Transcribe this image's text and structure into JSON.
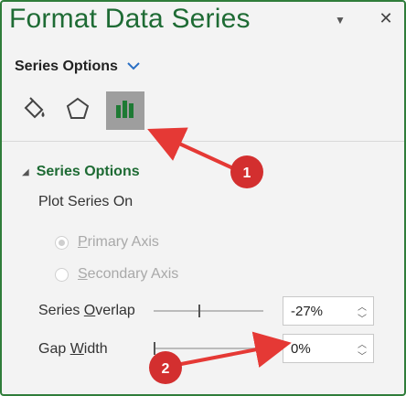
{
  "pane": {
    "title": "Format Data Series"
  },
  "header": {
    "dropdown_label": "Series Options"
  },
  "tabs": [
    {
      "name": "fill-line",
      "icon": "paint-bucket-icon"
    },
    {
      "name": "effects",
      "icon": "pentagon-icon"
    },
    {
      "name": "series-options",
      "icon": "bar-chart-icon",
      "active": true
    }
  ],
  "section": {
    "title": "Series Options",
    "plot_series_on": "Plot Series On",
    "primary_axis": "Primary Axis",
    "secondary_axis": "Secondary Axis",
    "series_overlap_label": "Series Overlap",
    "series_overlap_value": "-27%",
    "gap_width_label": "Gap Width",
    "gap_width_value": "0%"
  },
  "annotations": {
    "badge_1": "1",
    "badge_2": "2",
    "color": "#e53935"
  },
  "colors": {
    "accent_green": "#1e6b34",
    "border_green": "#2f7d3a",
    "chevron_blue": "#2a6fc4"
  }
}
